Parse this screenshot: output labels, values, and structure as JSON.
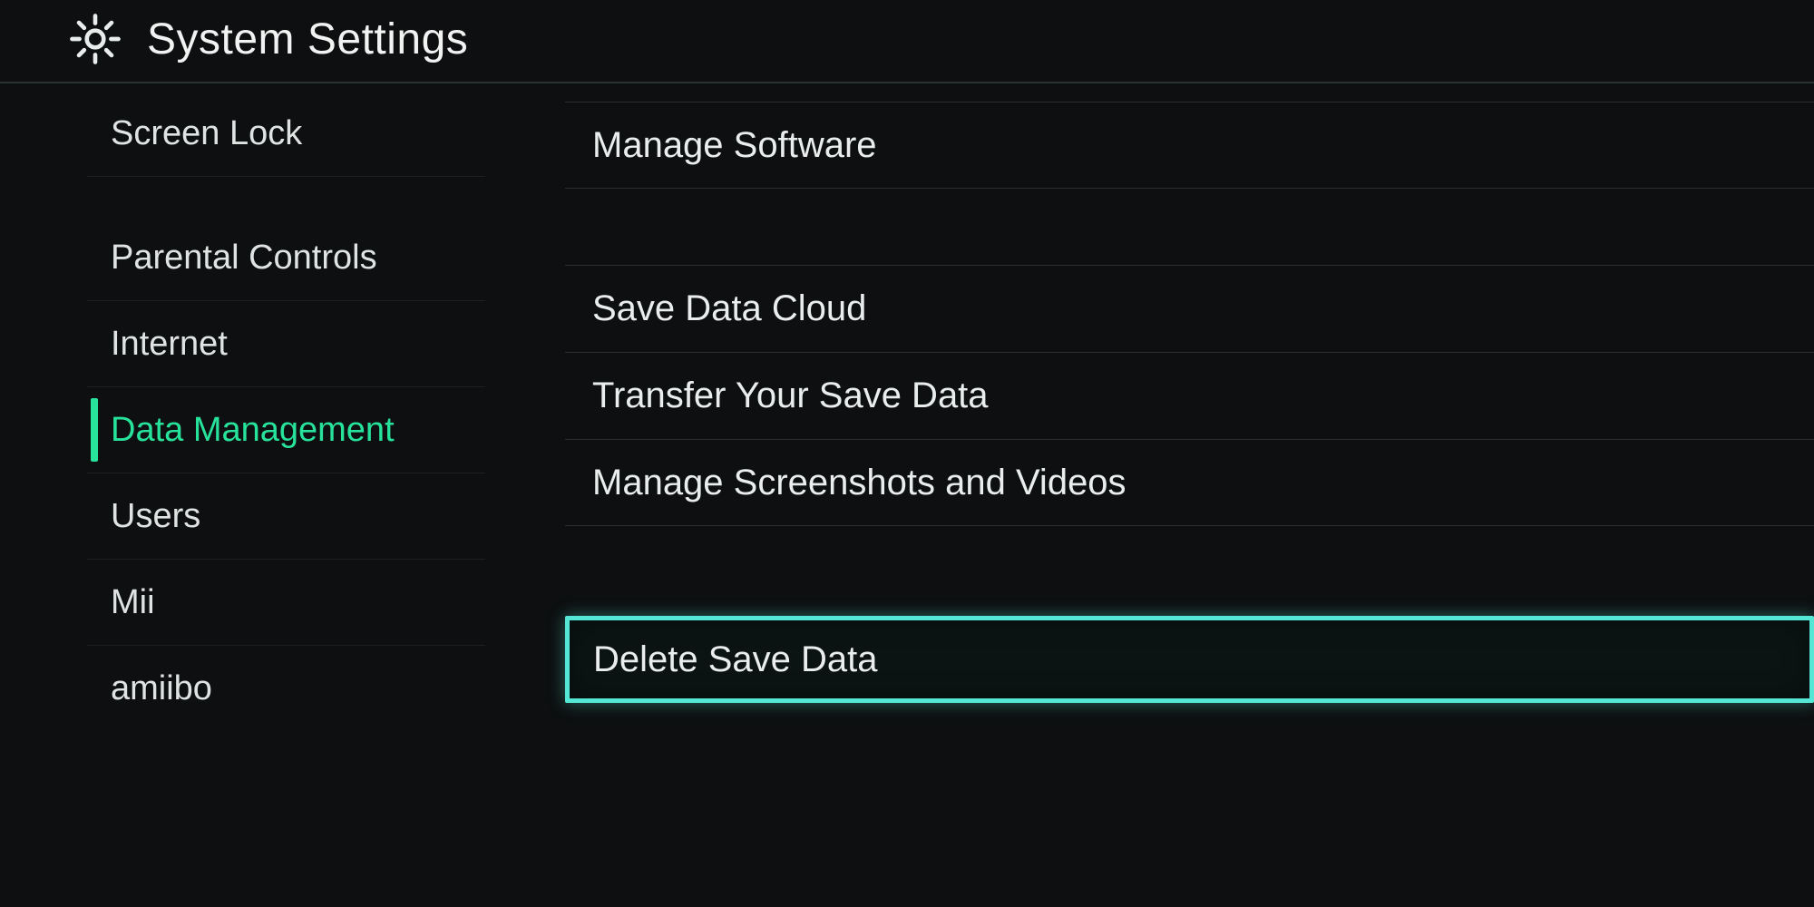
{
  "header": {
    "title": "System Settings"
  },
  "sidebar": {
    "items": [
      {
        "label": "Screen Lock",
        "active": false
      },
      {
        "label": "Parental Controls",
        "active": false
      },
      {
        "label": "Internet",
        "active": false
      },
      {
        "label": "Data Management",
        "active": true
      },
      {
        "label": "Users",
        "active": false
      },
      {
        "label": "Mii",
        "active": false
      },
      {
        "label": "amiibo",
        "active": false
      }
    ]
  },
  "main": {
    "items": [
      {
        "label": "Manage Software",
        "highlight": false
      },
      {
        "label": "Save Data Cloud",
        "highlight": false
      },
      {
        "label": "Transfer Your Save Data",
        "highlight": false
      },
      {
        "label": "Manage Screenshots and Videos",
        "highlight": false
      },
      {
        "label": "Delete Save Data",
        "highlight": true
      }
    ]
  },
  "colors": {
    "accent_green": "#27e29b",
    "highlight_teal": "#55e7d6"
  }
}
